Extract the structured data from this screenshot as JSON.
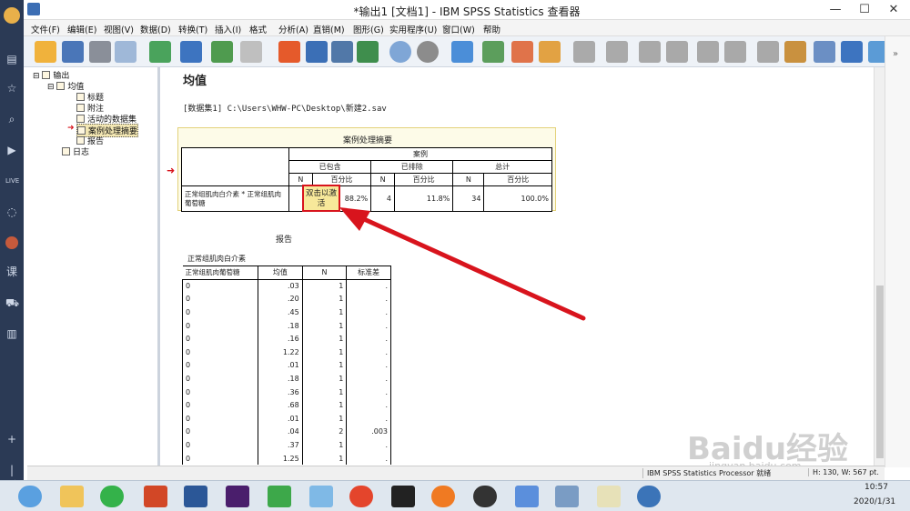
{
  "window": {
    "title": "*输出1 [文档1] - IBM SPSS Statistics 查看器"
  },
  "menu": [
    "文件(F)",
    "编辑(E)",
    "视图(V)",
    "数据(D)",
    "转换(T)",
    "插入(I)",
    "格式",
    "分析(A)",
    "直销(M)",
    "图形(G)",
    "实用程序(U)",
    "窗口(W)",
    "帮助"
  ],
  "outline": {
    "root": "输出",
    "group": "均值",
    "items": [
      "标题",
      "附注",
      "活动的数据集",
      "案例处理摘要",
      "报告"
    ],
    "log": "日志"
  },
  "content": {
    "heading": "均值",
    "dataset": "[数据集1] C:\\Users\\WHW-PC\\Desktop\\新建2.sav",
    "summary": {
      "title": "案例处理摘要",
      "cases_header": "案例",
      "groups": [
        "已包含",
        "已排除",
        "总计"
      ],
      "subheads": [
        "N",
        "百分比",
        "N",
        "百分比",
        "N",
        "百分比"
      ],
      "row_label": "正常组肌肉白介素 * 正常组肌肉葡萄糖",
      "cells": [
        "",
        "88.2%",
        "4",
        "11.8%",
        "34",
        "100.0%"
      ],
      "callout": "双击以激活"
    },
    "report": {
      "title": "报告",
      "dependent": "正常组肌肉白介素",
      "columns": [
        "正常组肌肉葡萄糖",
        "均值",
        "N",
        "标准差"
      ],
      "rows": [
        [
          "0",
          ".03",
          "1",
          "."
        ],
        [
          "0",
          ".20",
          "1",
          "."
        ],
        [
          "0",
          ".45",
          "1",
          "."
        ],
        [
          "0",
          ".18",
          "1",
          "."
        ],
        [
          "0",
          ".16",
          "1",
          "."
        ],
        [
          "0",
          "1.22",
          "1",
          "."
        ],
        [
          "0",
          ".01",
          "1",
          "."
        ],
        [
          "0",
          ".18",
          "1",
          "."
        ],
        [
          "0",
          ".36",
          "1",
          "."
        ],
        [
          "0",
          ".68",
          "1",
          "."
        ],
        [
          "0",
          ".01",
          "1",
          "."
        ],
        [
          "0",
          ".04",
          "2",
          ".003"
        ],
        [
          "0",
          ".37",
          "1",
          "."
        ],
        [
          "0",
          "1.25",
          "1",
          "."
        ]
      ]
    }
  },
  "status": {
    "processor": "IBM SPSS Statistics Processor 就绪",
    "size": "H: 130, W: 567 pt."
  },
  "taskbar": {
    "time": "10:57",
    "date": "2020/1/31"
  },
  "watermark": "Baidu经验",
  "watermark_url": "jingyan.baidu.com",
  "colors": {
    "arrow": "#d8141d",
    "highlight": "#f7e89a",
    "callout_border": "#d8141d",
    "selection": "#f3e7b3"
  }
}
